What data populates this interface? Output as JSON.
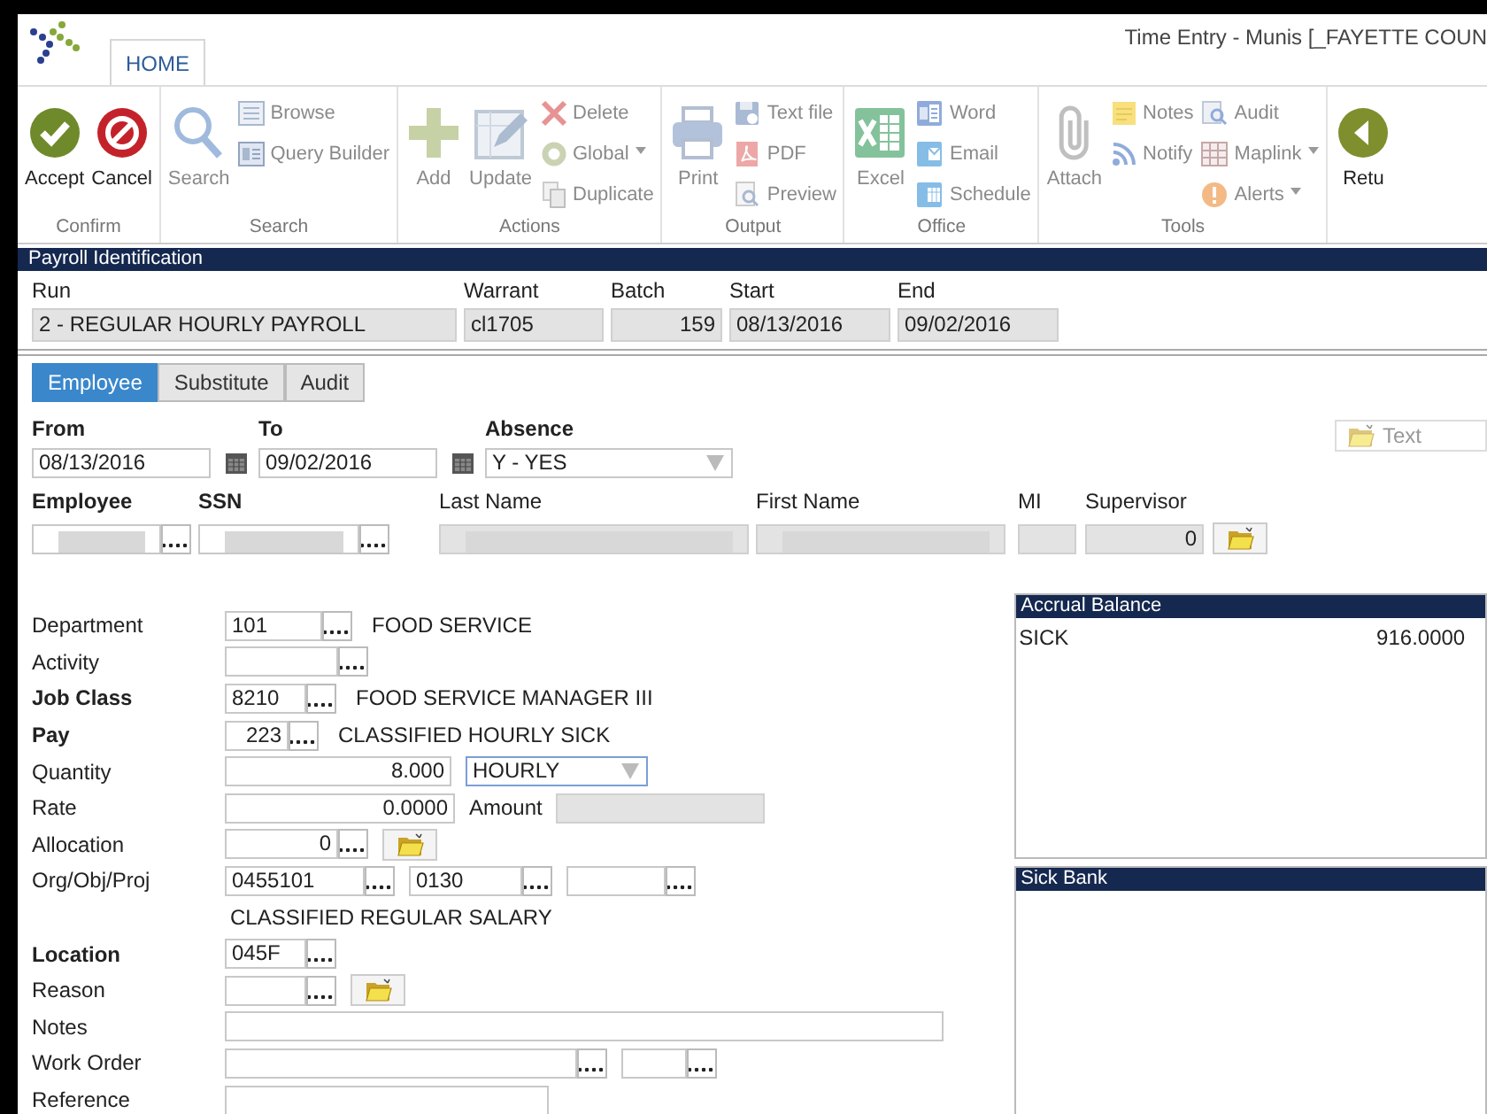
{
  "window": {
    "title": "Time Entry - Munis [_FAYETTE COUN"
  },
  "ribbon": {
    "tabs": [
      {
        "label": "HOME",
        "selected": true
      }
    ],
    "groups": [
      {
        "label": "Confirm",
        "columns": [
          [
            {
              "label": "Accept",
              "kind": "accept",
              "disabled": false
            }
          ],
          [
            {
              "label": "Cancel",
              "kind": "cancel",
              "disabled": false
            }
          ]
        ]
      },
      {
        "label": "Search",
        "columns": [
          [
            {
              "label": "Search",
              "kind": "search",
              "disabled": true
            }
          ],
          [
            {
              "label": "Browse",
              "kind": "browse",
              "disabled": true
            },
            {
              "label": "Query Builder",
              "kind": "query",
              "disabled": true
            }
          ]
        ]
      },
      {
        "label": "Actions",
        "columns": [
          [
            {
              "label": "Add",
              "kind": "add",
              "disabled": true
            }
          ],
          [
            {
              "label": "Update",
              "kind": "update",
              "disabled": true
            }
          ],
          [
            {
              "label": "Delete",
              "kind": "delete",
              "disabled": true
            },
            {
              "label": "Global",
              "kind": "global",
              "disabled": true,
              "dropdown": true
            },
            {
              "label": "Duplicate",
              "kind": "duplicate",
              "disabled": true
            }
          ]
        ]
      },
      {
        "label": "Output",
        "columns": [
          [
            {
              "label": "Print",
              "kind": "print",
              "disabled": true
            }
          ],
          [
            {
              "label": "Text file",
              "kind": "textfile",
              "disabled": true
            },
            {
              "label": "PDF",
              "kind": "pdf",
              "disabled": true
            },
            {
              "label": "Preview",
              "kind": "preview",
              "disabled": true
            }
          ]
        ]
      },
      {
        "label": "Office",
        "columns": [
          [
            {
              "label": "Excel",
              "kind": "excel",
              "disabled": true
            }
          ],
          [
            {
              "label": "Word",
              "kind": "word",
              "disabled": true
            },
            {
              "label": "Email",
              "kind": "email",
              "disabled": true
            },
            {
              "label": "Schedule",
              "kind": "schedule",
              "disabled": true
            }
          ]
        ]
      },
      {
        "label": "Tools",
        "columns": [
          [
            {
              "label": "Attach",
              "kind": "attach",
              "disabled": true
            }
          ],
          [
            {
              "label": "Notes",
              "kind": "notes",
              "disabled": true
            },
            {
              "label": "Notify",
              "kind": "notify",
              "disabled": true
            }
          ],
          [
            {
              "label": "Audit",
              "kind": "audit",
              "disabled": true
            },
            {
              "label": "Maplink",
              "kind": "maplink",
              "disabled": true,
              "dropdown": true
            },
            {
              "label": "Alerts",
              "kind": "alerts",
              "disabled": true,
              "dropdown": true
            }
          ]
        ]
      },
      {
        "columns": [
          [
            {
              "label": "Retu",
              "kind": "return",
              "disabled": false
            }
          ]
        ]
      }
    ]
  },
  "payroll": {
    "title": "Payroll Identification",
    "fields": [
      {
        "label": "Run",
        "value": "2 - REGULAR HOURLY PAYROLL"
      },
      {
        "label": "Warrant",
        "value": "cl1705"
      },
      {
        "label": "Batch",
        "value": "159"
      },
      {
        "label": "Start",
        "value": "08/13/2016"
      },
      {
        "label": "End",
        "value": "09/02/2016"
      }
    ]
  },
  "tabs": [
    {
      "label": "Employee",
      "selected": true
    },
    {
      "label": "Substitute",
      "selected": false
    },
    {
      "label": "Audit",
      "selected": false
    }
  ],
  "period": [
    {
      "label": "From",
      "kind": "date",
      "value": "08/13/2016"
    },
    {
      "label": "To",
      "kind": "date",
      "value": "09/02/2016"
    },
    {
      "label": "Absence",
      "kind": "select",
      "value": "Y - YES"
    }
  ],
  "text_button": {
    "label": "Text",
    "disabled": true
  },
  "employee": [
    {
      "label": "Employee",
      "bold": true,
      "readonly": false,
      "masked": true,
      "lookup": true
    },
    {
      "label": "SSN",
      "bold": true,
      "readonly": false,
      "masked": true,
      "lookup": true
    },
    {
      "label": "Last Name",
      "bold": false,
      "readonly": true,
      "masked": true,
      "lookup": false
    },
    {
      "label": "First Name",
      "bold": false,
      "readonly": true,
      "masked": true,
      "lookup": false
    },
    {
      "label": "MI",
      "bold": false,
      "readonly": true,
      "masked": false,
      "lookup": false
    },
    {
      "label": "Supervisor",
      "bold": false,
      "readonly": true,
      "masked": false,
      "lookup": false,
      "value": "0"
    }
  ],
  "details": [
    {
      "label": "Department",
      "bold": false,
      "controls": [
        {
          "kind": "code",
          "value": "101"
        },
        {
          "kind": "text",
          "value": "FOOD SERVICE"
        }
      ]
    },
    {
      "label": "Activity",
      "bold": false,
      "controls": [
        {
          "kind": "code"
        }
      ]
    },
    {
      "label": "Job Class",
      "bold": true,
      "controls": [
        {
          "kind": "code",
          "value": "8210"
        },
        {
          "kind": "text",
          "value": "FOOD SERVICE MANAGER III"
        }
      ]
    },
    {
      "label": "Pay",
      "bold": true,
      "controls": [
        {
          "kind": "numcode",
          "value": "223"
        },
        {
          "kind": "text",
          "value": "CLASSIFIED HOURLY SICK"
        }
      ]
    },
    {
      "label": "Quantity",
      "bold": false,
      "controls": [
        {
          "kind": "number",
          "value": "8.000"
        },
        {
          "kind": "select",
          "value": "HOURLY",
          "focused": true
        }
      ]
    },
    {
      "label": "Rate",
      "bold": false,
      "controls": [
        {
          "kind": "number",
          "value": "0.0000"
        },
        {
          "kind": "label",
          "value": "Amount"
        },
        {
          "kind": "readonly"
        }
      ]
    },
    {
      "label": "Allocation",
      "bold": false,
      "controls": [
        {
          "kind": "numcode",
          "value": "0"
        },
        {
          "kind": "folder"
        }
      ]
    },
    {
      "label": "Org/Obj/Proj",
      "bold": false,
      "controls": [
        {
          "kind": "code",
          "value": "0455101"
        },
        {
          "kind": "code",
          "value": "0130"
        },
        {
          "kind": "code"
        }
      ]
    },
    {
      "controls": [
        {
          "kind": "text",
          "value": "CLASSIFIED REGULAR SALARY"
        }
      ]
    },
    {
      "label": "Location",
      "bold": true,
      "controls": [
        {
          "kind": "code",
          "value": "045F"
        }
      ]
    },
    {
      "label": "Reason",
      "bold": false,
      "controls": [
        {
          "kind": "code"
        },
        {
          "kind": "folder"
        }
      ]
    },
    {
      "label": "Notes",
      "bold": false,
      "controls": [
        {
          "kind": "field"
        }
      ]
    },
    {
      "label": "Work Order",
      "bold": false,
      "controls": [
        {
          "kind": "code"
        },
        {
          "kind": "code"
        }
      ]
    },
    {
      "label": "Reference",
      "bold": false,
      "controls": [
        {
          "kind": "field"
        }
      ]
    }
  ],
  "panels": [
    {
      "title": "Accrual Balance",
      "rows": [
        {
          "name": "SICK",
          "value": "916.0000"
        }
      ]
    },
    {
      "title": "Sick Bank"
    }
  ]
}
